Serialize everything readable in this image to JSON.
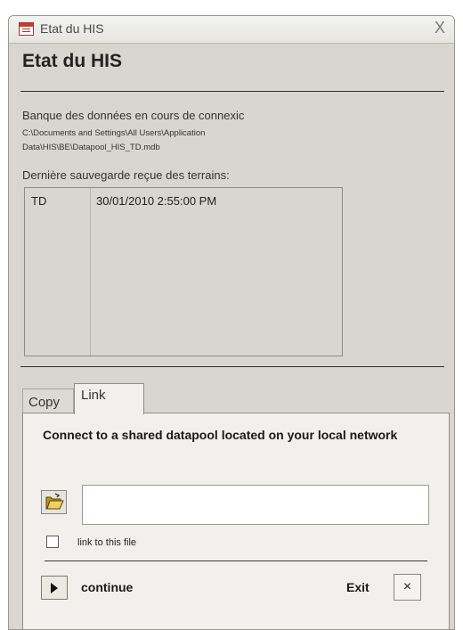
{
  "window": {
    "title": "Etat du HIS",
    "close_glyph": "X"
  },
  "form": {
    "heading": "Etat du HIS",
    "db_label": "Banque des données en cours de connexic",
    "db_path": "C:\\Documents and Settings\\All Users\\Application Data\\HIS\\BE\\Datapool_HIS_TD.mdb",
    "last_backup_label": "Dernière sauvegarde reçue des terrains:",
    "backups": [
      {
        "site": "TD",
        "datetime": "30/01/2010 2:55:00 PM"
      }
    ]
  },
  "tabs": [
    {
      "label": "Copy",
      "active": false
    },
    {
      "label": "Link",
      "active": true
    }
  ],
  "link_panel": {
    "instruction": "Connect to a shared datapool located on your local network",
    "path_value": "",
    "checkbox_label": "link to this file",
    "checkbox_checked": false,
    "continue_label": "continue",
    "exit_label": "Exit",
    "exit_glyph": "×"
  },
  "icons": {
    "app": "access-form-icon",
    "browse": "open-folder-icon",
    "continue": "play-icon",
    "exit": "close-icon"
  },
  "colors": {
    "window_bg": "#d8d6d0",
    "panel_bg": "#f1f0ec",
    "app_icon_red": "#c53a33",
    "folder_yellow": "#e8c64a"
  }
}
